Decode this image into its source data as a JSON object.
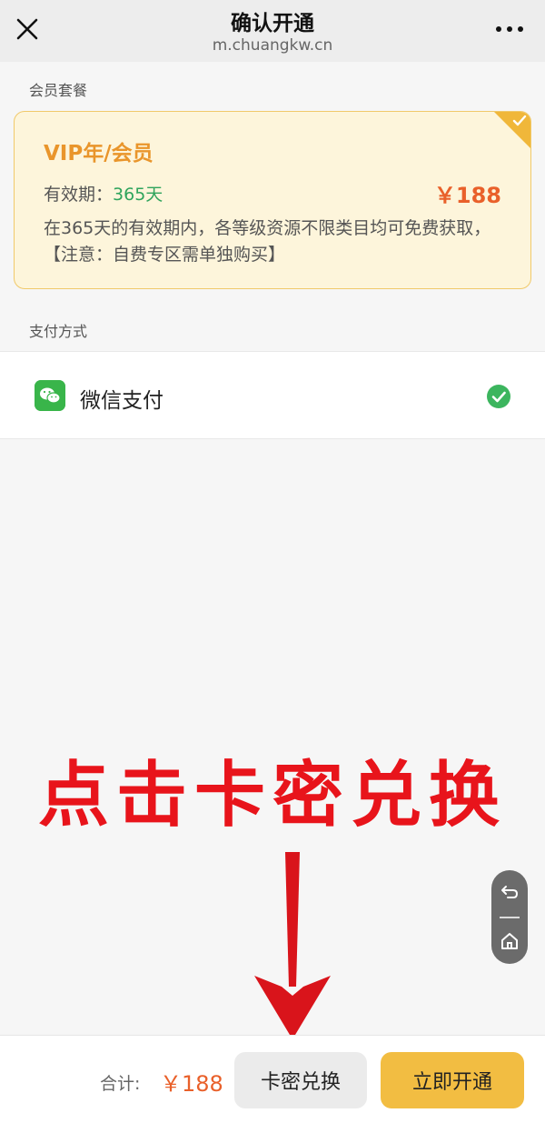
{
  "header": {
    "title": "确认开通",
    "subtitle": "m.chuangkw.cn",
    "close_icon": "close-icon",
    "more_icon": "more-icon"
  },
  "plan_section": {
    "label": "会员套餐",
    "plan": {
      "name": "VIP年/会员",
      "validity_label": "有效期：",
      "validity_value": "365天",
      "price": "￥188",
      "description": "在365天的有效期内，各等级资源不限类目均可免费获取，【注意：自费专区需单独购买】",
      "selected": true
    }
  },
  "payment_section": {
    "label": "支付方式",
    "method": {
      "name": "微信支付",
      "icon": "wechat-icon",
      "selected": true
    }
  },
  "annotation": {
    "text": "点击卡密兑换"
  },
  "bottom_bar": {
    "total_label": "合计:",
    "total_price": "￥188",
    "card_redeem_label": "卡密兑换",
    "open_now_label": "立即开通"
  },
  "colors": {
    "accent_orange": "#e9952b",
    "price_orange": "#e9602a",
    "green": "#2fa45c",
    "button_yellow": "#f2bd42",
    "annotation_red": "#e8141b"
  }
}
